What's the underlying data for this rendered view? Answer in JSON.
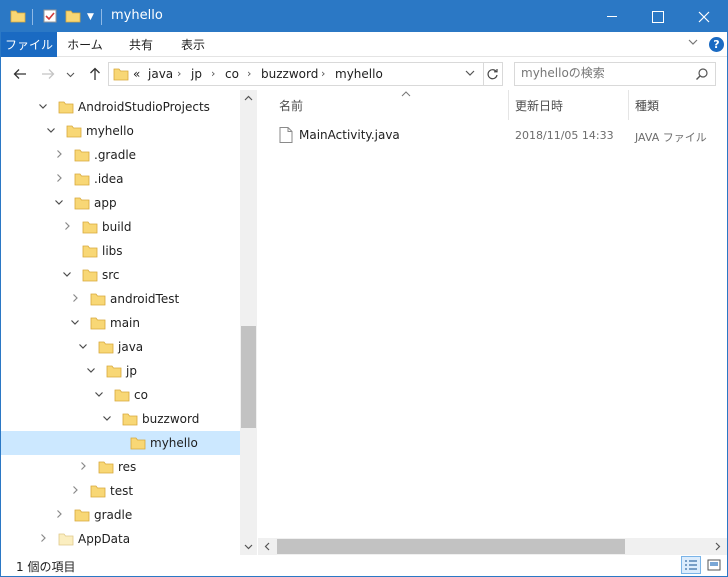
{
  "window": {
    "title": "myhello"
  },
  "ribbon": {
    "tabs": [
      "ファイル",
      "ホーム",
      "共有",
      "表示"
    ],
    "help": "?"
  },
  "address": {
    "overflow": "«",
    "crumbs": [
      "java",
      "jp",
      "co",
      "buzzword",
      "myhello"
    ]
  },
  "search": {
    "placeholder": "myhelloの検索"
  },
  "tree": [
    {
      "label": "AndroidStudioProjects",
      "depth": 0,
      "expanded": true
    },
    {
      "label": "myhello",
      "depth": 1,
      "expanded": true
    },
    {
      "label": ".gradle",
      "depth": 2,
      "expanded": false
    },
    {
      "label": ".idea",
      "depth": 2,
      "expanded": false
    },
    {
      "label": "app",
      "depth": 2,
      "expanded": true
    },
    {
      "label": "build",
      "depth": 3,
      "expanded": false
    },
    {
      "label": "libs",
      "depth": 3,
      "expanded": null
    },
    {
      "label": "src",
      "depth": 3,
      "expanded": true
    },
    {
      "label": "androidTest",
      "depth": 4,
      "expanded": false
    },
    {
      "label": "main",
      "depth": 4,
      "expanded": true
    },
    {
      "label": "java",
      "depth": 5,
      "expanded": true
    },
    {
      "label": "jp",
      "depth": 6,
      "expanded": true
    },
    {
      "label": "co",
      "depth": 7,
      "expanded": true
    },
    {
      "label": "buzzword",
      "depth": 8,
      "expanded": true
    },
    {
      "label": "myhello",
      "depth": 9,
      "expanded": null,
      "selected": true
    },
    {
      "label": "res",
      "depth": 5,
      "expanded": false
    },
    {
      "label": "test",
      "depth": 4,
      "expanded": false
    },
    {
      "label": "gradle",
      "depth": 2,
      "expanded": false
    },
    {
      "label": "AppData",
      "depth": 0,
      "expanded": false,
      "icon": "light-folder"
    }
  ],
  "columns": {
    "name": "名前",
    "date": "更新日時",
    "type": "種類"
  },
  "files": [
    {
      "name": "MainActivity.java",
      "date": "2018/11/05 14:33",
      "type": "JAVA ファイル"
    }
  ],
  "status": {
    "count": "1 個の項目"
  },
  "colors": {
    "titlebar": "#2b78c5",
    "file_tab": "#1a6ac2",
    "selection": "#cce8ff",
    "folder": "#f8d775"
  }
}
